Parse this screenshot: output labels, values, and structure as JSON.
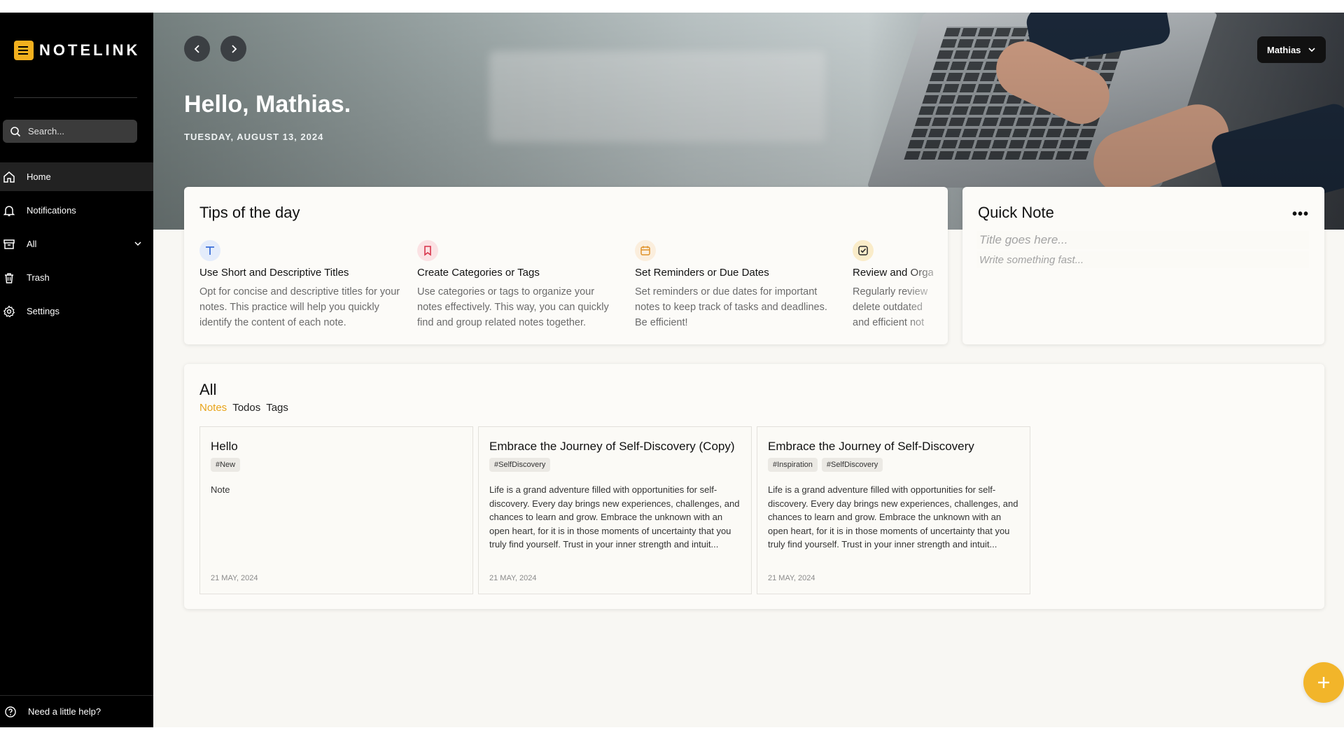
{
  "app": {
    "brand": "NOTELINK",
    "accent": "#f2b01e"
  },
  "sidebar": {
    "search_placeholder": "Search...",
    "items": [
      {
        "label": "Home",
        "icon": "home-icon",
        "active": true
      },
      {
        "label": "Notifications",
        "icon": "bell-icon"
      },
      {
        "label": "All",
        "icon": "archive-icon",
        "expandable": true
      },
      {
        "label": "Trash",
        "icon": "trash-icon"
      },
      {
        "label": "Settings",
        "icon": "gear-icon"
      }
    ],
    "help_label": "Need a little help?"
  },
  "header": {
    "greeting": "Hello, Mathias.",
    "date": "TUESDAY, AUGUST 13, 2024",
    "user_name": "Mathias"
  },
  "tips": {
    "title": "Tips of the day",
    "items": [
      {
        "icon": "text-icon",
        "title": "Use Short and Descriptive Titles",
        "text": "Opt for concise and descriptive titles for your notes. This practice will help you quickly identify the content of each note.",
        "color": "#3b6fd8",
        "bg": "#e4ecfb"
      },
      {
        "icon": "bookmark-icon",
        "title": "Create Categories or Tags",
        "text": "Use categories or tags to organize your notes effectively. This way, you can quickly find and group related notes together.",
        "color": "#d8334a",
        "bg": "#fbe2e4"
      },
      {
        "icon": "calendar-icon",
        "title": "Set Reminders or Due Dates",
        "text": "Set reminders or due dates for important notes to keep track of tasks and deadlines. Be efficient!",
        "color": "#e0922a",
        "bg": "#fbeedd"
      },
      {
        "icon": "checkbox-icon",
        "title": "Review and Orga",
        "text": "Regularly review delete outdated and efficient not",
        "color": "#2b2b2b",
        "bg": "#faecc9"
      }
    ]
  },
  "quick_note": {
    "title": "Quick Note",
    "more": "•••",
    "title_placeholder": "Title goes here...",
    "body_placeholder": "Write something fast..."
  },
  "all": {
    "title": "All",
    "tabs": [
      "Notes",
      "Todos",
      "Tags"
    ],
    "active_tab": "Notes",
    "notes": [
      {
        "title": "Hello",
        "tags": [
          "#New"
        ],
        "body": "Note",
        "date": "21 MAY, 2024"
      },
      {
        "title": "Embrace the Journey of Self-Discovery (Copy)",
        "tags": [
          "#SelfDiscovery"
        ],
        "body": "Life is a grand adventure filled with opportunities for self-discovery. Every day brings new experiences, challenges, and chances to learn and grow. Embrace the unknown with an open heart, for it is in those moments of uncertainty that you truly find yourself. Trust in your inner strength and intuit...",
        "date": "21 MAY, 2024"
      },
      {
        "title": "Embrace the Journey of Self-Discovery",
        "tags": [
          "#Inspiration",
          "#SelfDiscovery"
        ],
        "body": "Life is a grand adventure filled with opportunities for self-discovery. Every day brings new experiences, challenges, and chances to learn and grow. Embrace the unknown with an open heart, for it is in those moments of uncertainty that you truly find yourself. Trust in your inner strength and intuit...",
        "date": "21 MAY, 2024"
      }
    ]
  },
  "fab": {
    "icon": "plus-icon"
  }
}
